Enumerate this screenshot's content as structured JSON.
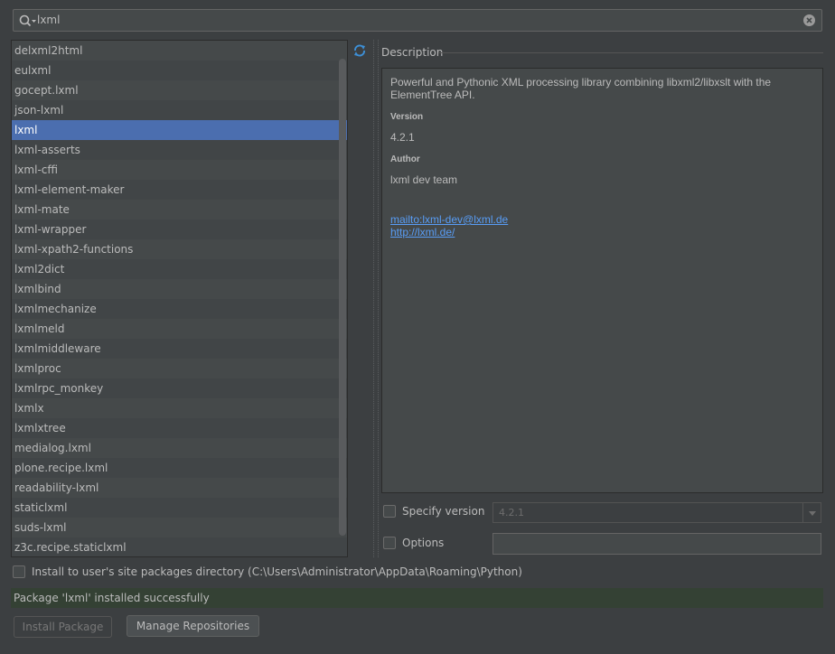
{
  "search": {
    "value": "lxml"
  },
  "packages": [
    "delxml2html",
    "eulxml",
    "gocept.lxml",
    "json-lxml",
    "lxml",
    "lxml-asserts",
    "lxml-cffi",
    "lxml-element-maker",
    "lxml-mate",
    "lxml-wrapper",
    "lxml-xpath2-functions",
    "lxml2dict",
    "lxmlbind",
    "lxmlmechanize",
    "lxmlmeld",
    "lxmlmiddleware",
    "lxmlproc",
    "lxmlrpc_monkey",
    "lxmlx",
    "lxmlxtree",
    "medialog.lxml",
    "plone.recipe.lxml",
    "readability-lxml",
    "staticlxml",
    "suds-lxml",
    "z3c.recipe.staticlxml"
  ],
  "selected_package": "lxml",
  "description": {
    "title": "Description",
    "summary": "Powerful and Pythonic XML processing library combining libxml2/libxslt with the ElementTree API.",
    "version_label": "Version",
    "version": "4.2.1",
    "author_label": "Author",
    "author": "lxml dev team",
    "mailto": "mailto:lxml-dev@lxml.de",
    "homepage": "http://lxml.de/"
  },
  "options": {
    "specify_version_label": "Specify version",
    "specify_version_value": "4.2.1",
    "options_label": "Options",
    "options_value": "",
    "install_user_label": "Install to user's site packages directory (C:\\Users\\Administrator\\AppData\\Roaming\\Python)"
  },
  "status": "Package 'lxml' installed successfully",
  "buttons": {
    "install": "Install Package",
    "manage": "Manage Repositories"
  },
  "colors": {
    "background": "#3c3f41",
    "selection": "#4b6eaf",
    "link": "#589df6",
    "status_bg": "#344134"
  }
}
